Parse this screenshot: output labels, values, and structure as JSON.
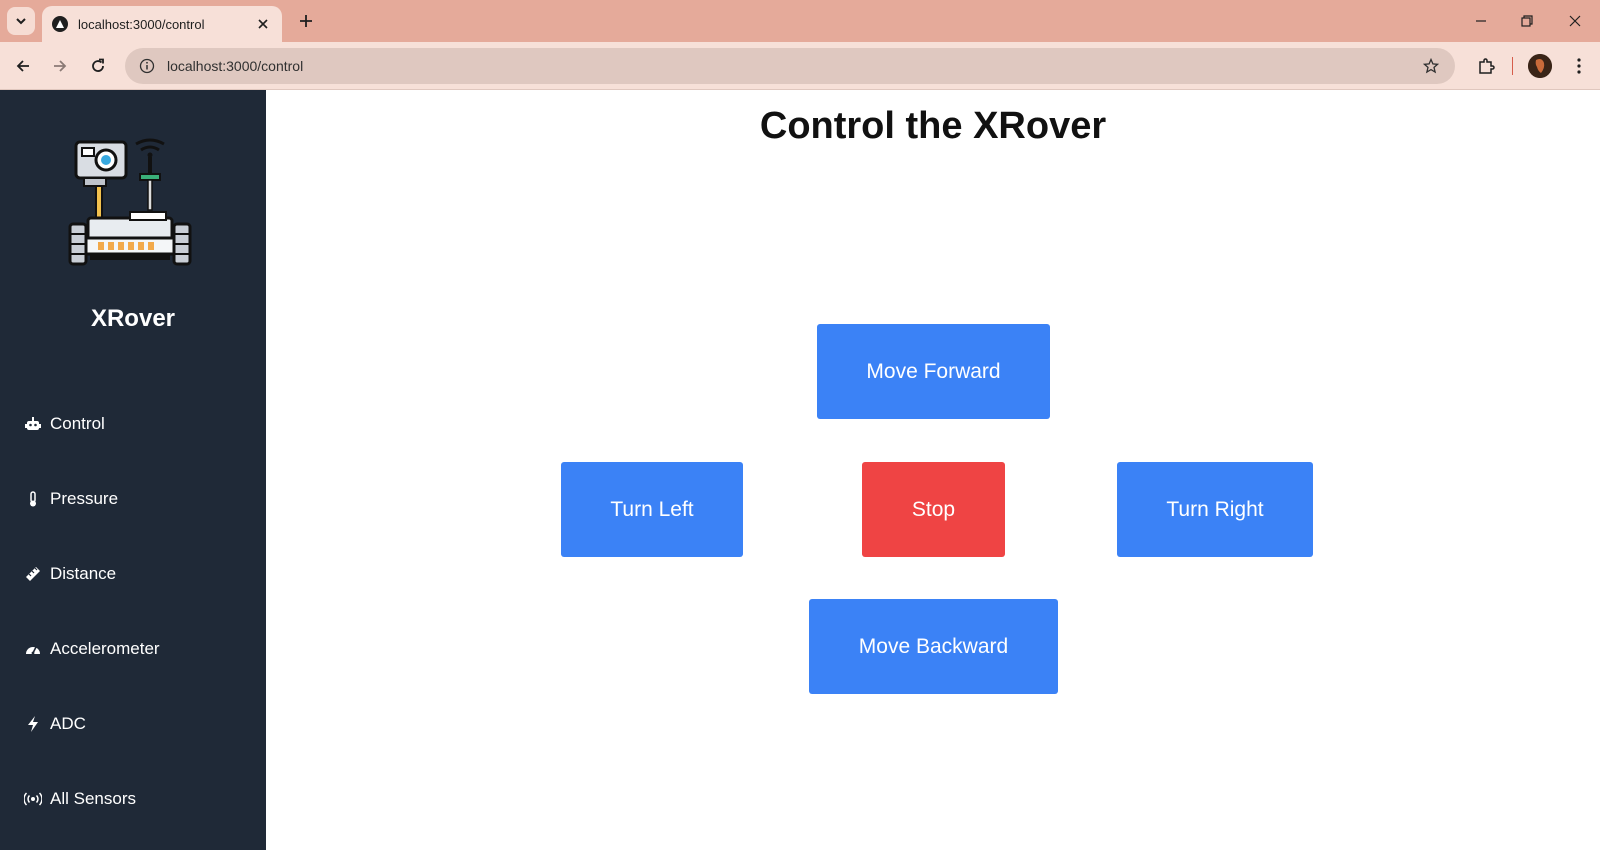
{
  "browser": {
    "tab_title": "localhost:3000/control",
    "url": "localhost:3000/control"
  },
  "sidebar": {
    "brand": "XRover",
    "items": [
      {
        "label": "Control",
        "icon": "robot-icon"
      },
      {
        "label": "Pressure",
        "icon": "thermometer-icon"
      },
      {
        "label": "Distance",
        "icon": "ruler-icon"
      },
      {
        "label": "Accelerometer",
        "icon": "gauge-icon"
      },
      {
        "label": "ADC",
        "icon": "bolt-icon"
      },
      {
        "label": "All Sensors",
        "icon": "broadcast-icon"
      }
    ]
  },
  "main": {
    "title": "Control the XRover",
    "controls": {
      "forward": "Move Forward",
      "left": "Turn Left",
      "stop": "Stop",
      "right": "Turn Right",
      "backward": "Move Backward"
    }
  },
  "colors": {
    "sidebar_bg": "#1f2937",
    "button_blue": "#3b82f6",
    "button_red": "#ef4444",
    "tabstrip": "#e5aa9a"
  }
}
